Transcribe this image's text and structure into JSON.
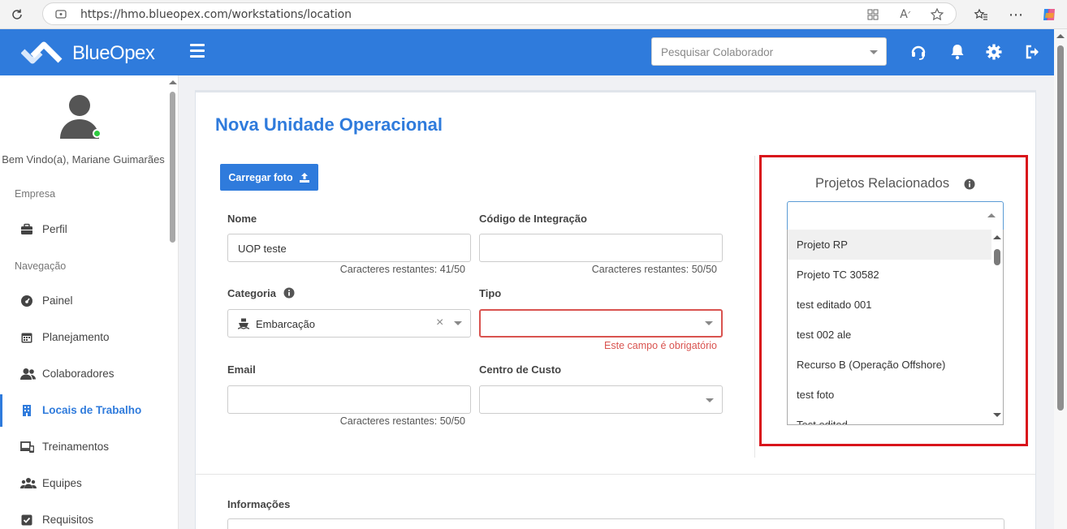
{
  "browser": {
    "url": "https://hmo.blueopex.com/workstations/location"
  },
  "header": {
    "brand": "BlueOpex",
    "search_placeholder": "Pesquisar Colaborador"
  },
  "sidebar": {
    "welcome": "Bem Vindo(a), Mariane Guimarães",
    "section_company": "Empresa",
    "section_navigation": "Navegação",
    "items": [
      {
        "label": "Perfil",
        "icon": "briefcase-icon"
      },
      {
        "label": "Painel",
        "icon": "gauge-icon"
      },
      {
        "label": "Planejamento",
        "icon": "calendar-icon"
      },
      {
        "label": "Colaboradores",
        "icon": "users-icon"
      },
      {
        "label": "Locais de Trabalho",
        "icon": "building-icon",
        "active": true
      },
      {
        "label": "Treinamentos",
        "icon": "devices-icon"
      },
      {
        "label": "Equipes",
        "icon": "team-icon"
      },
      {
        "label": "Requisitos",
        "icon": "checkbox-icon"
      }
    ]
  },
  "form": {
    "title": "Nova Unidade Operacional",
    "upload_label": "Carregar foto",
    "name_label": "Nome",
    "name_value": "UOP teste",
    "name_hint": "Caracteres restantes: 41/50",
    "code_label": "Código de Integração",
    "code_hint": "Caracteres restantes: 50/50",
    "category_label": "Categoria",
    "category_value": "Embarcação",
    "type_label": "Tipo",
    "type_error": "Este campo é obrigatório",
    "email_label": "Email",
    "email_hint": "Caracteres restantes: 50/50",
    "cost_center_label": "Centro de Custo",
    "info_label": "Informações"
  },
  "projects": {
    "title": "Projetos Relacionados",
    "options": [
      "Projeto RP",
      "Projeto TC 30582",
      "test editado 001",
      "test 002 ale",
      "Recurso B (Operação Offshore)",
      "test foto",
      "Test edited"
    ]
  },
  "colors": {
    "primary": "#2f7bdc",
    "error": "#d9534f",
    "highlight": "#d9141b"
  }
}
